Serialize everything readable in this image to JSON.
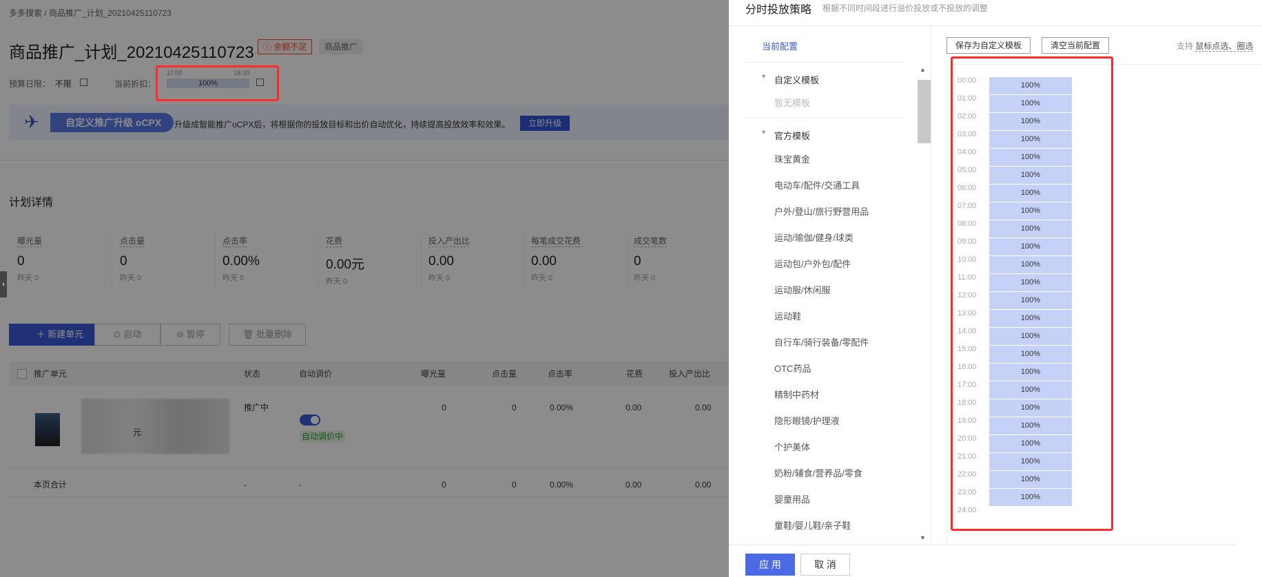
{
  "left": {
    "breadcrumb": "多多搜索 / 商品推广_计划_20210425110723",
    "plan_title": "商品推广_计划_20210425110723",
    "badge_balance": "余额不足",
    "badge_type": "商品推广",
    "budget_label": "预算日限：",
    "budget_value": "不限",
    "discount_label": "当前折扣：",
    "discount_tick_start": "17:00",
    "discount_tick_end": "18:00",
    "discount_value": "100%",
    "banner_pill": "自定义推广升级 oCPX",
    "banner_text": "升级成智能推广oCPX后，将根据你的投放目标和出价自动优化，持续提高投放效率和效果。",
    "banner_button": "立即升级",
    "section_title": "计划详情",
    "stats": [
      {
        "label": "曝光量",
        "value": "0",
        "yesterday": "昨天 0"
      },
      {
        "label": "点击量",
        "value": "0",
        "yesterday": "昨天 0"
      },
      {
        "label": "点击率",
        "value": "0.00%",
        "yesterday": "昨天 0"
      },
      {
        "label": "花费",
        "value": "0.00元",
        "yesterday": "昨天 0"
      },
      {
        "label": "投入产出比",
        "value": "0.00",
        "yesterday": "昨天 0"
      },
      {
        "label": "每笔成交花费",
        "value": "0.00",
        "yesterday": "昨天 0"
      },
      {
        "label": "成交笔数",
        "value": "0",
        "yesterday": "昨天 0"
      }
    ],
    "toolbar": {
      "new_unit": "＋ 新建单元",
      "start": "启动",
      "pause": "暂停",
      "batch_delete": "批量删除"
    },
    "table": {
      "headers": [
        "推广单元",
        "状态",
        "自动调价",
        "曝光量",
        "点击量",
        "点击率",
        "花费",
        "投入产出比"
      ],
      "row1": {
        "suffix": "元",
        "status": "推广中",
        "auto_tag": "自动调价中",
        "exposure": "0",
        "clicks": "0",
        "ctr": "0.00%",
        "cost": "0.00",
        "roi": "0.00"
      },
      "row2": {
        "name": "本页合计",
        "status": "-",
        "auto": "-",
        "exposure": "0",
        "clicks": "0",
        "ctr": "0.00%",
        "cost": "0.00",
        "roi": "0.00"
      }
    }
  },
  "drawer": {
    "title": "分时投放策略",
    "subtitle": "根据不同时间段进行溢价投放或不投放的调整",
    "current_config": "当前配置",
    "custom_group": "自定义模板",
    "no_template": "暂无模板",
    "official_group": "官方模板",
    "official_items": [
      "珠宝黄金",
      "电动车/配件/交通工具",
      "户外/登山/旅行野营用品",
      "运动/瑜伽/健身/球类",
      "运动包/户外包/配件",
      "运动服/休闲服",
      "运动鞋",
      "自行车/骑行装备/零配件",
      "OTC药品",
      "精制中药材",
      "隐形眼镜/护理液",
      "个护美体",
      "奶粉/辅食/营养品/零食",
      "婴童用品",
      "童鞋/婴儿鞋/亲子鞋"
    ],
    "save_template_button": "保存为自定义模板",
    "clear_button": "清空当前配置",
    "support_text": "支持",
    "support_link": "鼠标点选、圈选",
    "hours": [
      "00:00",
      "01:00",
      "02:00",
      "03:00",
      "04:00",
      "05:00",
      "06:00",
      "07:00",
      "08:00",
      "09:00",
      "10:00",
      "11:00",
      "12:00",
      "13:00",
      "14:00",
      "15:00",
      "16:00",
      "17:00",
      "18:00",
      "19:00",
      "20:00",
      "21:00",
      "22:00",
      "23:00",
      "24:00"
    ],
    "hour_values": [
      "100%",
      "100%",
      "100%",
      "100%",
      "100%",
      "100%",
      "100%",
      "100%",
      "100%",
      "100%",
      "100%",
      "100%",
      "100%",
      "100%",
      "100%",
      "100%",
      "100%",
      "100%",
      "100%",
      "100%",
      "100%",
      "100%",
      "100%",
      "100%"
    ],
    "apply_button": "应 用",
    "cancel_button": "取 消"
  }
}
